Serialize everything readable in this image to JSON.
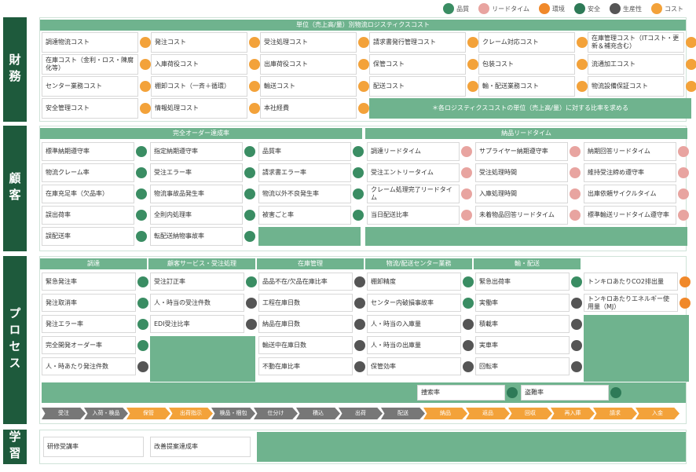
{
  "legend": [
    {
      "label": "品質",
      "color": "#3a8d63",
      "icon": "quality-icon"
    },
    {
      "label": "リードタイム",
      "color": "#e8a4a0",
      "icon": "leadtime-icon"
    },
    {
      "label": "環境",
      "color": "#f0892a",
      "icon": "environment-icon"
    },
    {
      "label": "安全",
      "color": "#2e7a57",
      "icon": "safety-icon"
    },
    {
      "label": "生産性",
      "color": "#555555",
      "icon": "productivity-icon"
    },
    {
      "label": "コスト",
      "color": "#f3a23a",
      "icon": "cost-icon"
    }
  ],
  "sections": {
    "finance": "財務",
    "customer": "顧客",
    "process": "プロセス",
    "learning": "学習"
  },
  "finance": {
    "header": "単位（売上高/量）別物流ロジスティクスコスト",
    "cells": [
      "調達物流コスト",
      "発注コスト",
      "受注処理コスト",
      "請求書発行管理コスト",
      "クレーム対応コスト",
      "在庫管理コスト（ITコスト・更新＆補充含む）",
      "在庫コスト（金利・ロス・陳腐化等）",
      "入庫荷役コスト",
      "出庫荷役コスト",
      "保管コスト",
      "包装コスト",
      "流通加工コスト",
      "センター業務コスト",
      "棚卸コスト（一斉＋循環）",
      "輸送コスト",
      "配送コスト",
      "輸・配送業務コスト",
      "物流設備保証コスト",
      "安全管理コスト",
      "情報処理コスト",
      "本社経費"
    ],
    "note": "＊各ロジスティクスコストの単位（売上高/量）に対する比率を求める"
  },
  "customer": {
    "left_header": "完全オーダー達成率",
    "right_header": "納品リードタイム",
    "left_cells": [
      "標準納期遵守率",
      "指定納期遵守率",
      "品質率",
      "物流クレーム率",
      "受注エラー率",
      "請求書エラー率",
      "在庫充足率（欠品率）",
      "物流事故品発生率",
      "物流以外不良発生率",
      "誤出荷率",
      "全則内処理率",
      "被害ごと率",
      "誤配送率",
      "転配送納物事故率"
    ],
    "right_cells": [
      "調達リードタイム",
      "サプライヤー納期遵守率",
      "納期回答リードタイム",
      "受注エントリータイム",
      "受注処理時間",
      "維持受注締め遵守率",
      "クレーム処理完了リードタイム",
      "入庫処理時間",
      "出庫依頼サイクルタイム",
      "当日配送比率",
      "未着物品回答リードタイム",
      "標準輸送リードタイム遵守率"
    ]
  },
  "process": {
    "headers": [
      "調達",
      "顧客サービス・受注処理",
      "在庫管理",
      "物流/配送センター業務",
      "輸・配送"
    ],
    "col1": [
      "緊急発注率",
      "発注取消率",
      "発注エラー率",
      "完全開発オーダー率",
      "人・時あたり発注件数"
    ],
    "col2": [
      "受注訂正率",
      "人・時当の受注件数",
      "EDI受注比率"
    ],
    "col3": [
      "品品不在/欠品在庫比率",
      "工程在庫日数",
      "納品在庫日数",
      "輸送中在庫日数",
      "不動在庫比率"
    ],
    "col4": [
      "棚卸精度",
      "センター内破損事故率",
      "人・時当の入庫量",
      "人・時当の出庫量",
      "保管効率"
    ],
    "col5": [
      "緊急出荷率",
      "実働率",
      "積載率",
      "実車率",
      "回転率"
    ],
    "col6": [
      "トンキロあたりCO2排出量",
      "トンキロあたりエネルギー使用量（MJ）"
    ],
    "bottom_cells": [
      "捜索率",
      "盗難率"
    ],
    "flow": [
      {
        "label": "受注",
        "type": "g"
      },
      {
        "label": "入荷・検品",
        "type": "g"
      },
      {
        "label": "保管",
        "type": "o"
      },
      {
        "label": "出荷指示",
        "type": "o"
      },
      {
        "label": "検品・梱包",
        "type": "g"
      },
      {
        "label": "仕分け",
        "type": "g"
      },
      {
        "label": "積込",
        "type": "g"
      },
      {
        "label": "出荷",
        "type": "g"
      },
      {
        "label": "配送",
        "type": "g"
      },
      {
        "label": "納品",
        "type": "o"
      },
      {
        "label": "返品",
        "type": "o"
      },
      {
        "label": "回収",
        "type": "o"
      },
      {
        "label": "再入庫",
        "type": "o"
      },
      {
        "label": "請求",
        "type": "o"
      },
      {
        "label": "入金",
        "type": "o"
      }
    ]
  },
  "learning": {
    "cells": [
      "研修受講率",
      "改善提案達成率"
    ]
  }
}
